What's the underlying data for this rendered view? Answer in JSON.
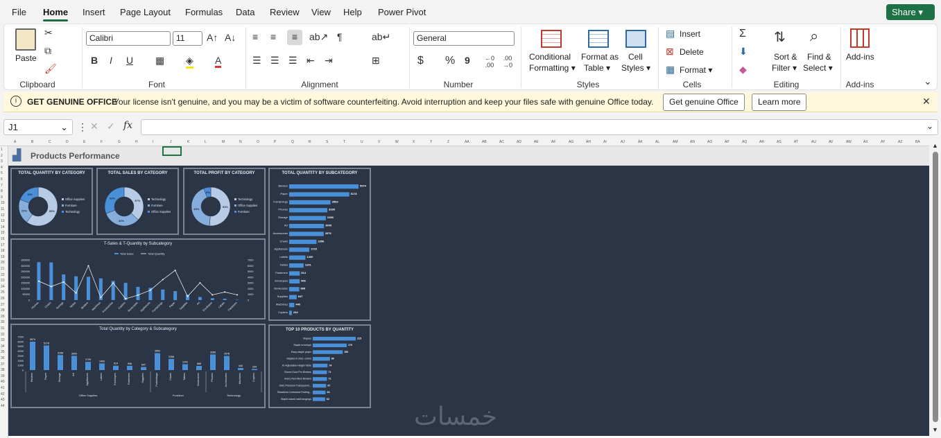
{
  "menu": {
    "tabs": [
      "File",
      "Home",
      "Insert",
      "Page Layout",
      "Formulas",
      "Data",
      "Review",
      "View",
      "Help",
      "Power Pivot"
    ],
    "share_label": "Share"
  },
  "ribbon": {
    "clipboard": {
      "group": "Clipboard",
      "paste": "Paste"
    },
    "font": {
      "group": "Font",
      "family": "Calibri",
      "size": "11",
      "bold": "B",
      "italic": "I",
      "underline": "U"
    },
    "alignment": {
      "group": "Alignment"
    },
    "number": {
      "group": "Number",
      "format": "General",
      "currency": "$",
      "percent": "%",
      "comma": "9",
      "inc": "←0 .00",
      "dec": ".00 →0"
    },
    "styles": {
      "group": "Styles",
      "conditional": "Conditional",
      "conditional2": "Formatting",
      "format_table": "Format as",
      "format_table2": "Table",
      "cell_styles": "Cell",
      "cell_styles2": "Styles"
    },
    "cells": {
      "group": "Cells",
      "insert": "Insert",
      "delete": "Delete",
      "format": "Format"
    },
    "editing": {
      "group": "Editing",
      "sort": "Sort &",
      "sort2": "Filter",
      "find": "Find &",
      "find2": "Select"
    },
    "addins": {
      "group": "Add-ins",
      "label": "Add-ins"
    }
  },
  "notice": {
    "title": "GET GENUINE OFFICE",
    "message": "Your license isn't genuine, and you may be a victim of software counterfeiting. Avoid interruption and keep your files safe with genuine Office today.",
    "btn_genuine": "Get genuine Office",
    "btn_learn": "Learn more"
  },
  "formula_bar": {
    "name_box": "J1",
    "fx": "fx",
    "value": ""
  },
  "columns": [
    "A",
    "B",
    "C",
    "D",
    "E",
    "F",
    "G",
    "H",
    "I",
    "J",
    "K",
    "L",
    "M",
    "N",
    "O",
    "P",
    "Q",
    "R",
    "S",
    "T",
    "U",
    "V",
    "W",
    "X",
    "Y",
    "Z",
    "AA",
    "AB",
    "AC",
    "AD",
    "AE",
    "AF",
    "AG",
    "AH",
    "AI",
    "AJ",
    "AK",
    "AL",
    "AM",
    "AN",
    "AO",
    "AP",
    "AQ",
    "AR",
    "AS",
    "AT",
    "AU",
    "AV",
    "AW",
    "AX",
    "AY",
    "AZ",
    "BA"
  ],
  "dashboard": {
    "title": "Products Performance",
    "watermark": "خمسات",
    "colors": {
      "bg": "#2b3545",
      "bar": "#4a90d9",
      "light": "#b7cbe6",
      "line": "#ffffff"
    }
  },
  "chart_data": [
    {
      "type": "pie",
      "title": "TOTAL QUANTITY BY CATEGORY",
      "categories": [
        "Office Supplies",
        "Furniture",
        "Technology"
      ],
      "values": [
        60,
        21,
        19
      ],
      "labels": [
        "60%",
        "21%",
        "19%"
      ]
    },
    {
      "type": "pie",
      "title": "TOTAL SALES BY CATEGORY",
      "categories": [
        "Technology",
        "Furniture",
        "Office Supplies"
      ],
      "values": [
        37,
        32,
        31
      ],
      "labels": [
        "37%",
        "32%",
        "31%"
      ]
    },
    {
      "type": "pie",
      "title": "TOTAL PROFIT BY CATEGORY",
      "categories": [
        "Technology",
        "Office Supplies",
        "Furniture"
      ],
      "values": [
        51,
        43,
        6
      ],
      "labels": [
        "51%",
        "43%",
        "6%"
      ]
    },
    {
      "type": "bar",
      "title": "TOTAL QUANTITY BY SUBCATEGORY",
      "orientation": "horizontal",
      "categories": [
        "Binders",
        "Paper",
        "Furnishings",
        "Phones",
        "Storage",
        "Art",
        "Accessories",
        "Chairs",
        "Appliances",
        "Labels",
        "Tables",
        "Fasteners",
        "Envelopes",
        "Bookcases",
        "Supplies",
        "Machines",
        "Copiers"
      ],
      "values": [
        5974,
        5178,
        3563,
        3289,
        3158,
        3000,
        2976,
        2356,
        1729,
        1400,
        1241,
        914,
        906,
        868,
        647,
        440,
        234
      ]
    },
    {
      "type": "line",
      "title": "T-Sales & T-Quantity by Subcategory",
      "series": [
        {
          "name": "Total Sales"
        },
        {
          "name": "Total Quantity"
        }
      ],
      "categories": [
        "Phones",
        "Chairs",
        "Storage",
        "Tables",
        "Binders",
        "Machines",
        "Accessories",
        "Copiers",
        "Bookcases",
        "Appliances",
        "Furnishings",
        "Paper",
        "Supplies",
        "Art",
        "Envelopes",
        "Labels",
        "Fasteners"
      ],
      "sales": [
        330000,
        328000,
        223000,
        207000,
        203000,
        189000,
        167000,
        150000,
        115000,
        107000,
        92000,
        78000,
        47000,
        27000,
        16000,
        12000,
        3000
      ],
      "quantity": [
        3289,
        2356,
        3158,
        1241,
        5974,
        440,
        2976,
        234,
        868,
        1729,
        3563,
        5178,
        647,
        3000,
        906,
        1400,
        914
      ],
      "ylim_left": [
        0,
        350000
      ],
      "ylim_right": [
        0,
        7000
      ],
      "left_ticks": [
        "350000",
        "300000",
        "250000",
        "200000",
        "150000",
        "100000",
        "50000",
        "0"
      ],
      "right_ticks": [
        "7000",
        "6000",
        "5000",
        "4000",
        "3000",
        "2000",
        "1000",
        "0"
      ]
    },
    {
      "type": "bar",
      "title": "Total Quantity by Category & Subcategory",
      "categories": [
        "Binders",
        "Paper",
        "Storage",
        "Art",
        "Appliances",
        "Labels",
        "Envelopes",
        "Fasteners",
        "Supplies",
        "Furnishings",
        "Chairs",
        "Tables",
        "Bookcases",
        "Phones",
        "Accessories",
        "Machines",
        "Copiers"
      ],
      "values": [
        5974,
        5178,
        3158,
        3000,
        1729,
        1400,
        914,
        906,
        647,
        3563,
        2356,
        1241,
        868,
        3289,
        2976,
        440,
        234
      ],
      "groups": [
        {
          "name": "Office Supplies",
          "span": 9
        },
        {
          "name": "Furniture",
          "span": 4
        },
        {
          "name": "Technology",
          "span": 4
        }
      ],
      "ylim": [
        0,
        7000
      ],
      "ticks": [
        "7000",
        "6000",
        "5000",
        "4000",
        "3000",
        "2000",
        "1000",
        "0"
      ]
    },
    {
      "type": "bar",
      "title": "TOP 10 PRODUCTS BY QUANTITY",
      "orientation": "horizontal",
      "categories": [
        "Staples",
        "Staple envelope",
        "Easy-staple paper",
        "Staples in misc. colors",
        "KI Adjustable-Height Table",
        "Storex Dura Pro Binders",
        "Avery Non-Stick Binders",
        "GBC Premium Transparent...",
        "Situations Contoured Folding...",
        "Staple-based wall hangings"
      ],
      "values": [
        215,
        170,
        150,
        86,
        74,
        71,
        71,
        67,
        64,
        62
      ]
    }
  ]
}
